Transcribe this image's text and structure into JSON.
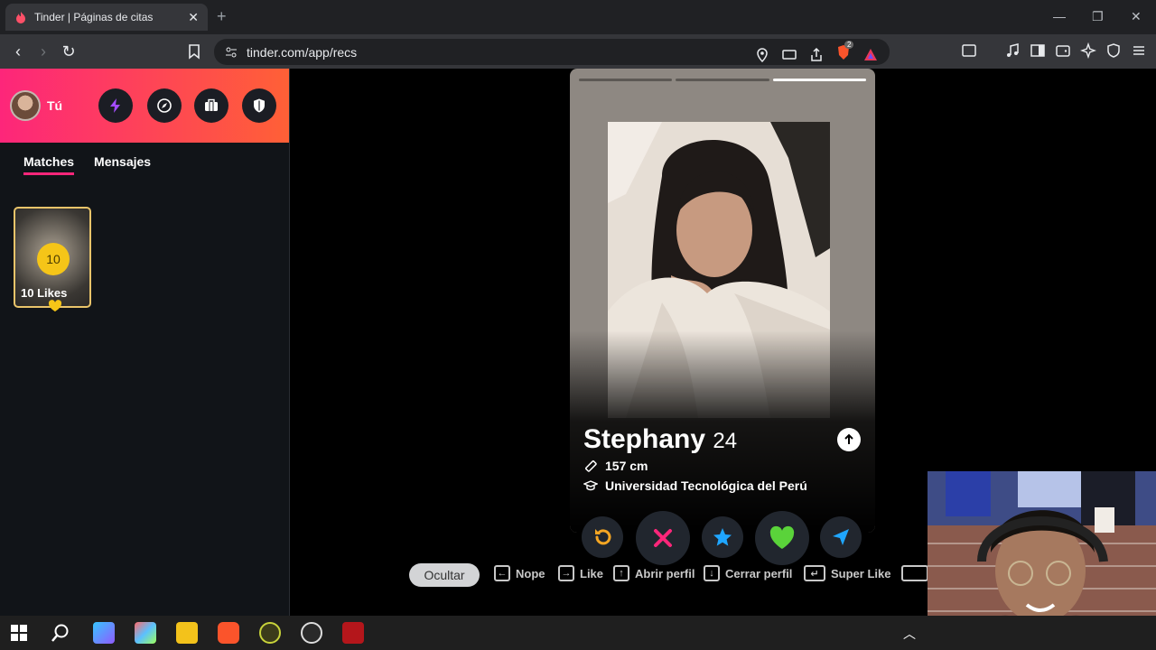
{
  "browser": {
    "tab_title": "Tinder | Páginas de citas",
    "tab_close": "✕",
    "new_tab": "+",
    "url": "tinder.com/app/recs",
    "brave_badge": "2"
  },
  "sidebar": {
    "user_label": "Tú",
    "tabs": [
      {
        "label": "Matches",
        "active": true
      },
      {
        "label": "Mensajes",
        "active": false
      }
    ],
    "likes_card": {
      "count": "10",
      "label": "10 Likes"
    }
  },
  "profile": {
    "photo_count": 3,
    "active_photo": 3,
    "name": "Stephany",
    "age": "24",
    "height": "157 cm",
    "school": "Universidad Tecnológica del Perú"
  },
  "actions": [
    "rewind",
    "nope",
    "super-like",
    "like",
    "boost"
  ],
  "shortcuts": {
    "hide_label": "Ocultar",
    "items": [
      {
        "key": "←",
        "label": "Nope"
      },
      {
        "key": "→",
        "label": "Like"
      },
      {
        "key": "↑",
        "label": "Abrir perfil"
      },
      {
        "key": "↓",
        "label": "Cerrar perfil"
      },
      {
        "key": "↵",
        "label": "Super Like"
      }
    ]
  },
  "colors": {
    "brand_gradient_start": "#fd267a",
    "brand_gradient_end": "#ff6036",
    "gold": "#e9c46a",
    "nope": "#fd267a",
    "like": "#5ad33a",
    "super_like": "#1fa6ff",
    "rewind": "#f5a623"
  }
}
